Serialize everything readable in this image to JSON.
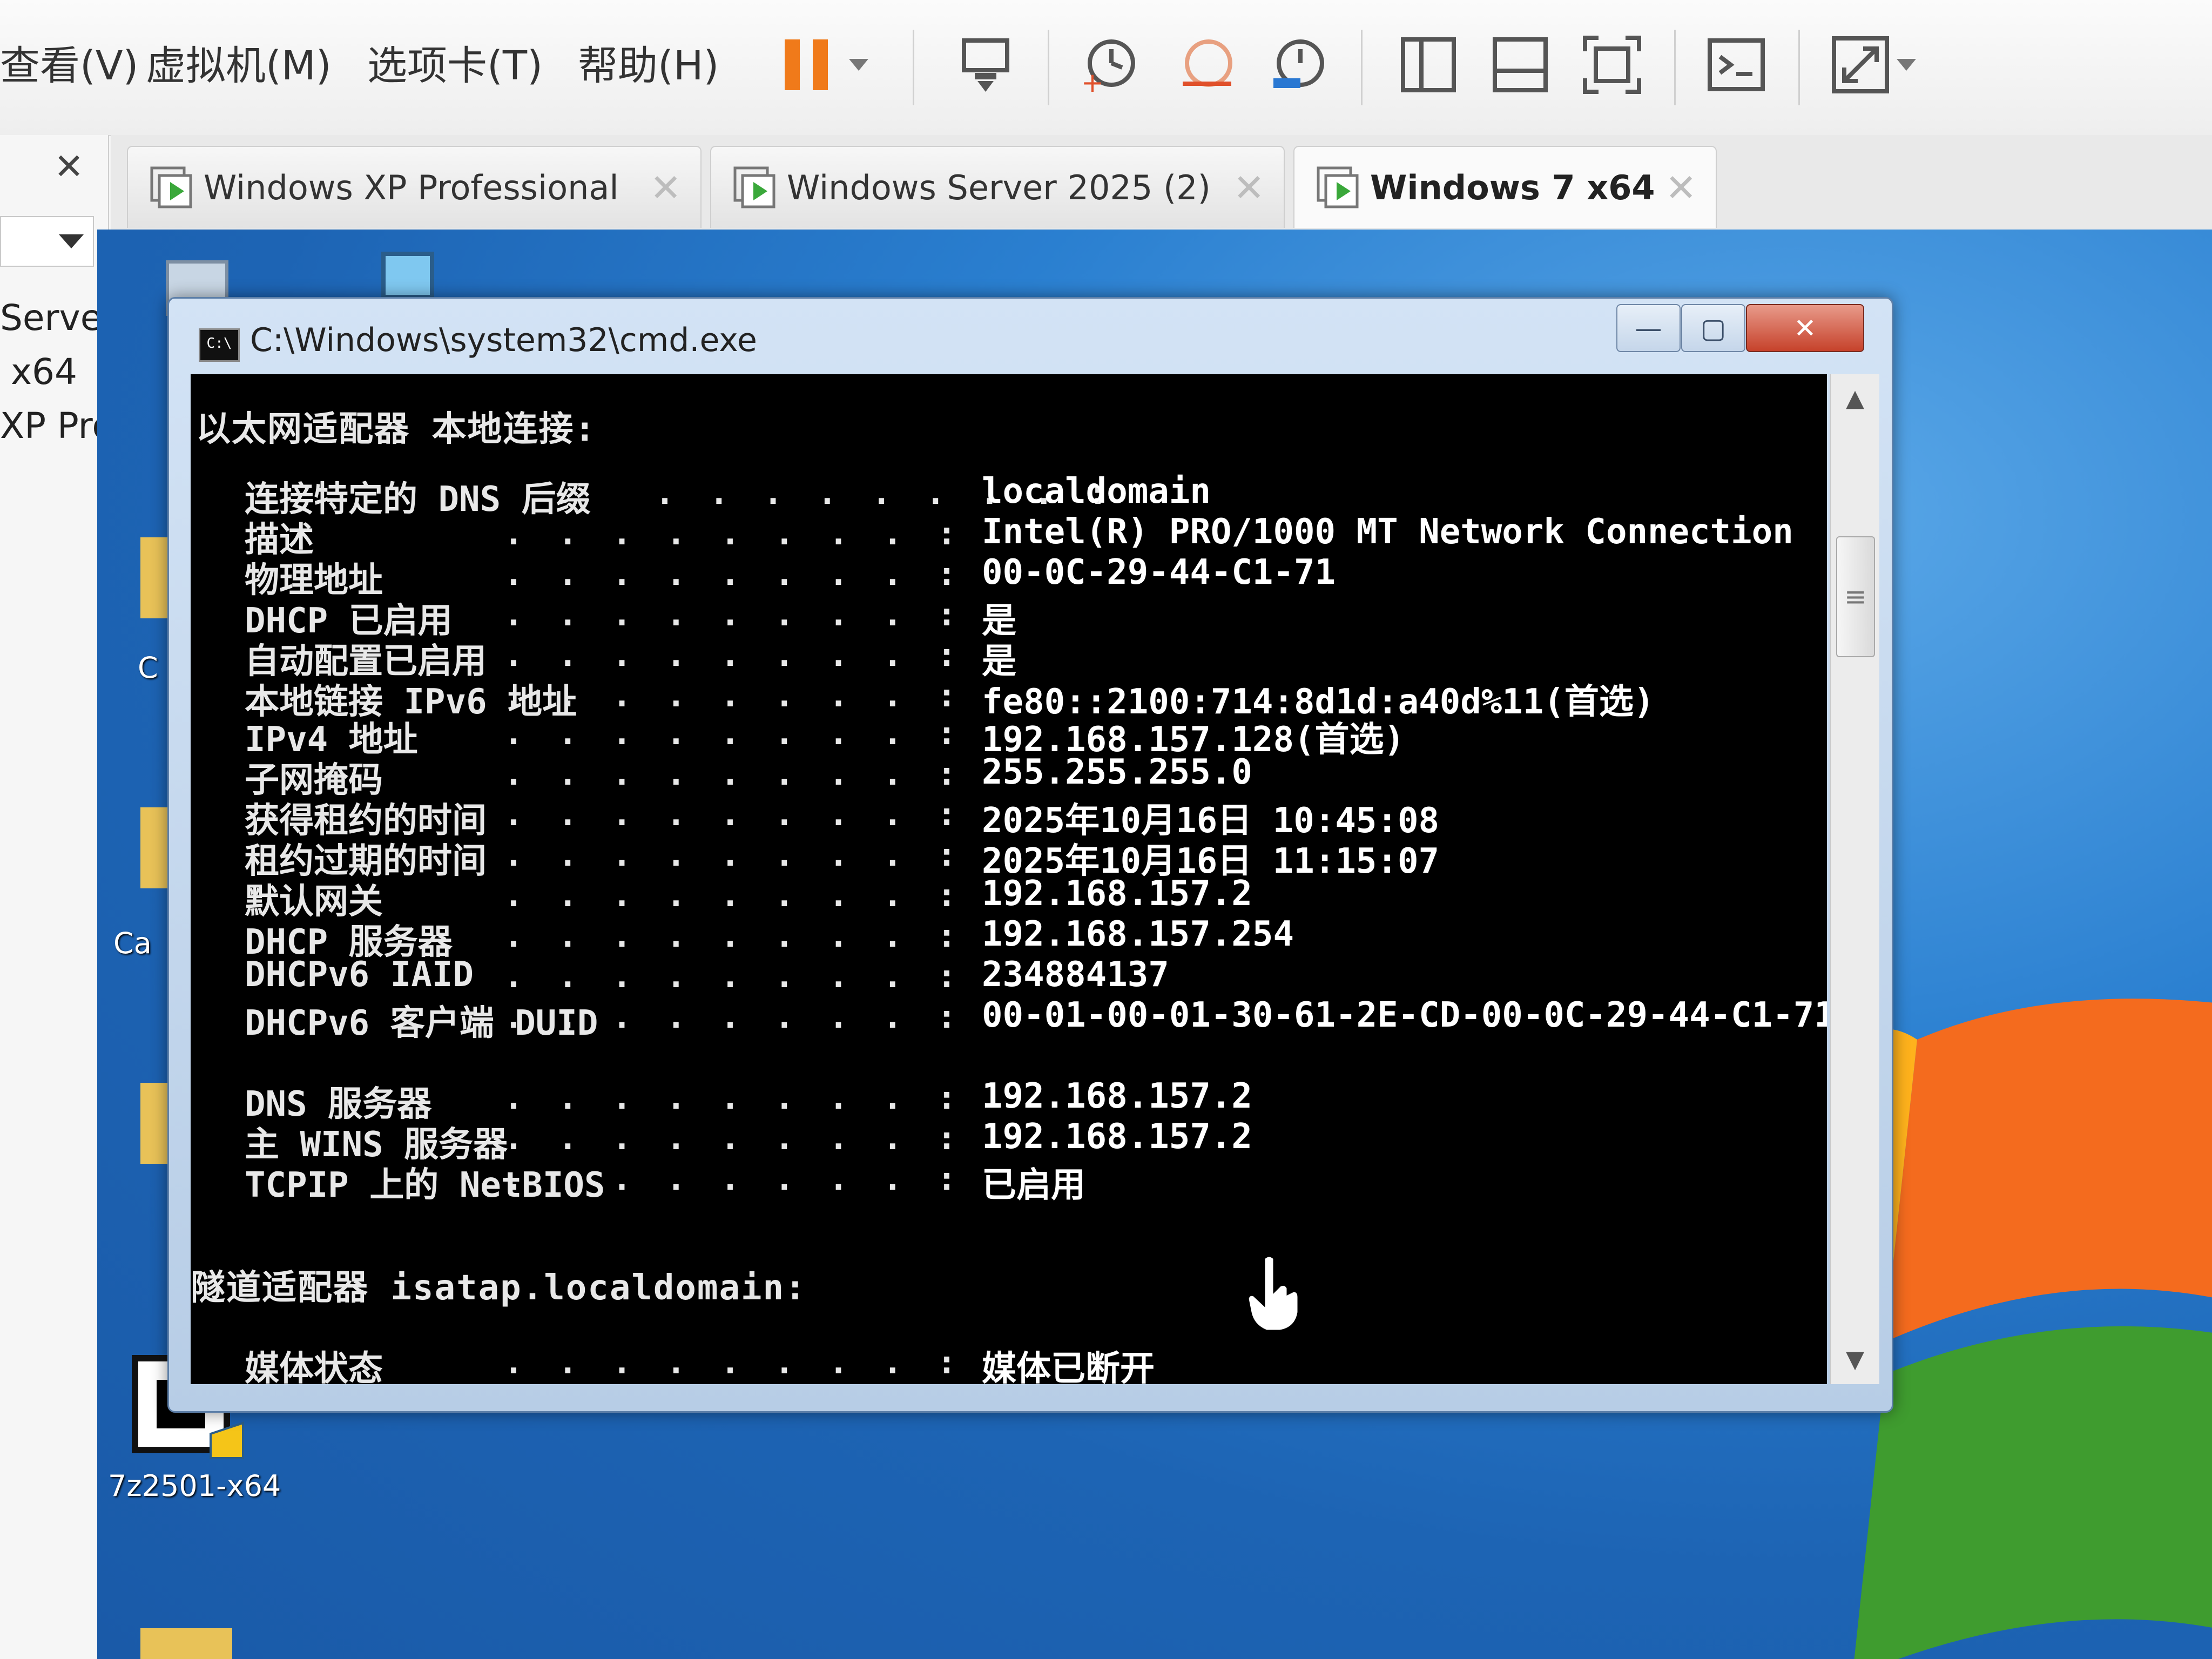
{
  "menubar": {
    "items": [
      "查看(V)",
      "虚拟机(M)",
      "选项卡(T)",
      "帮助(H)"
    ]
  },
  "toolbar": {
    "buttons": [
      "pause-icon",
      "dropdown-arrow-icon",
      "send-ctrl-alt-del-icon",
      "snapshot-icon",
      "revert-snapshot-icon",
      "snapshot-manager-icon",
      "show-library-icon",
      "thumbnail-bar-icon",
      "full-screen-icon",
      "console-icon",
      "unity-stretch-icon"
    ]
  },
  "library": {
    "items": [
      "Server",
      "x64",
      "XP Pro"
    ]
  },
  "tabs": [
    {
      "label": "Windows XP Professional",
      "active": false
    },
    {
      "label": "Windows Server 2025 (2)",
      "active": false
    },
    {
      "label": "Windows 7 x64",
      "active": true
    }
  ],
  "desktop": {
    "icon_labels": [
      "C",
      "Ca",
      "7z2501-x64"
    ]
  },
  "cmd": {
    "title": "C:\\Windows\\system32\\cmd.exe",
    "icon_text": "C:\\",
    "adapter1_header": "以太网适配器 本地连接:",
    "rows": [
      {
        "label": "连接特定的 DNS 后缀",
        "value": "localdomain"
      },
      {
        "label": "描述",
        "value": "Intel(R) PRO/1000 MT Network Connection"
      },
      {
        "label": "物理地址",
        "value": "00-0C-29-44-C1-71"
      },
      {
        "label": "DHCP 已启用",
        "value": "是"
      },
      {
        "label": "自动配置已启用",
        "value": "是"
      },
      {
        "label": "本地链接 IPv6 地址",
        "value": "fe80::2100:714:8d1d:a40d%11(首选)"
      },
      {
        "label": "IPv4 地址",
        "value": "192.168.157.128(首选)"
      },
      {
        "label": "子网掩码",
        "value": "255.255.255.0"
      },
      {
        "label": "获得租约的时间",
        "value": "2025年10月16日 10:45:08"
      },
      {
        "label": "租约过期的时间",
        "value": "2025年10月16日 11:15:07"
      },
      {
        "label": "默认网关",
        "value": "192.168.157.2"
      },
      {
        "label": "DHCP 服务器",
        "value": "192.168.157.254"
      },
      {
        "label": "DHCPv6 IAID",
        "value": "234884137"
      },
      {
        "label": "DHCPv6 客户端 DUID",
        "value": "00-01-00-01-30-61-2E-CD-00-0C-29-44-C1-71"
      },
      {
        "label": "DNS 服务器",
        "value": "192.168.157.2"
      },
      {
        "label": "主 WINS 服务器",
        "value": "192.168.157.2"
      },
      {
        "label": "TCPIP 上的 NetBIOS",
        "value": "已启用"
      }
    ],
    "dots": ". . . . . . . . :",
    "adapter2_header": "隧道适配器 isatap.localdomain:",
    "media_label": "媒体状态",
    "media_value": "媒体已断开"
  }
}
